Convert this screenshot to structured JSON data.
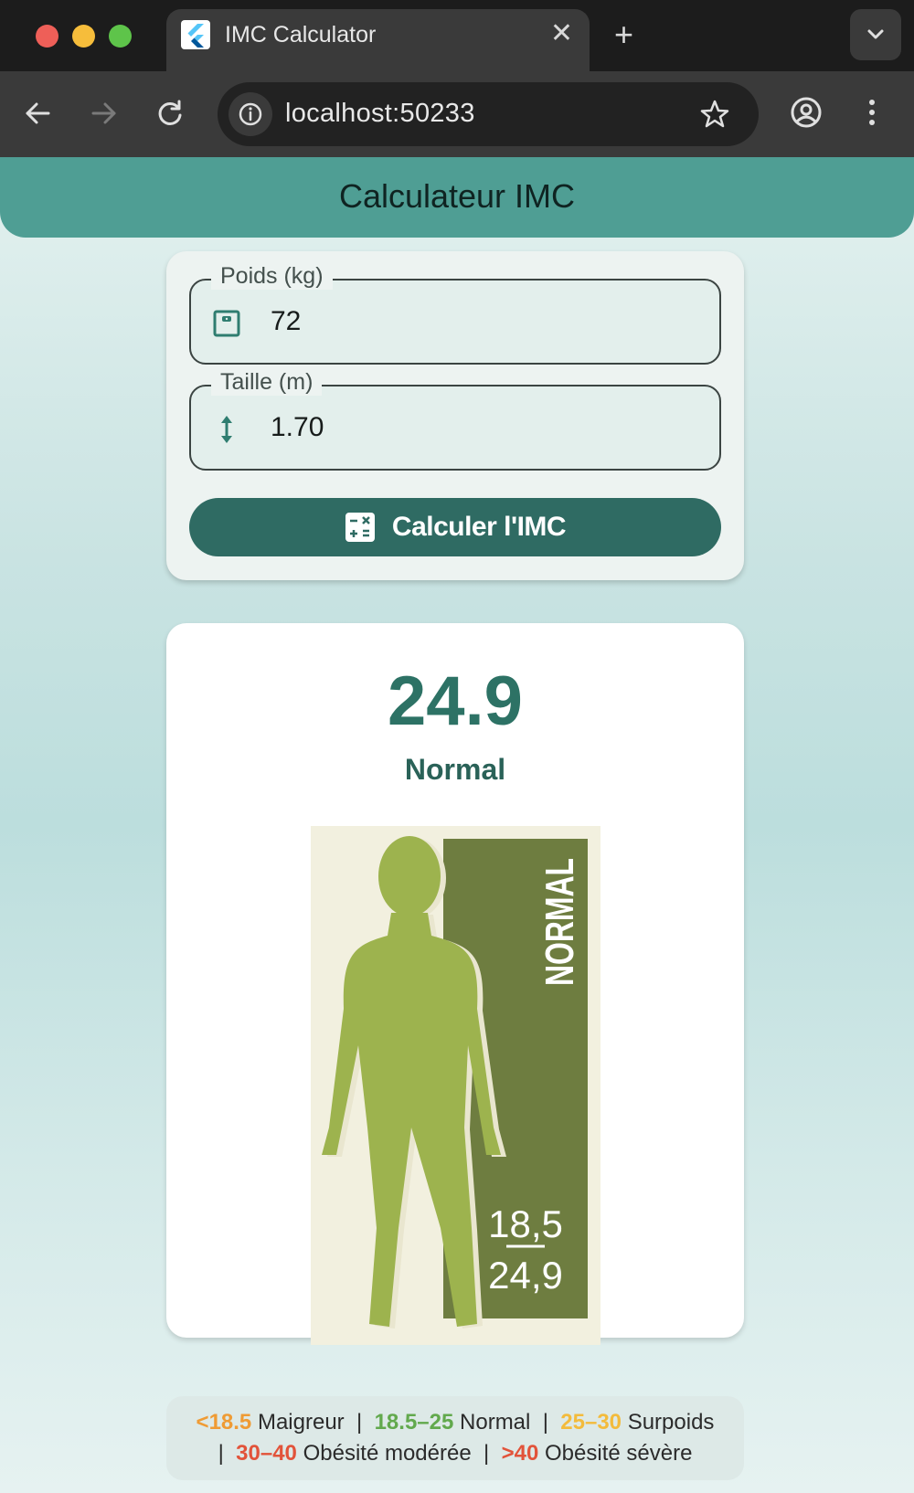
{
  "browser": {
    "tab_title": "IMC Calculator",
    "tab_close": "✕",
    "new_tab": "+",
    "url": "localhost:50233"
  },
  "app": {
    "title": "Calculateur IMC",
    "weight_field": {
      "label": "Poids (kg)",
      "value": "72"
    },
    "height_field": {
      "label": "Taille (m)",
      "value": "1.70"
    },
    "calculate_button": "Calculer l'IMC",
    "result": {
      "bmi": "24.9",
      "category": "Normal"
    },
    "figure_image": {
      "band_label": "NORMAL",
      "range_low": "18,5",
      "range_high": "24,9",
      "colors": {
        "background": "#f2f0df",
        "band": "#6e7d40",
        "silhouette": "#9db34e"
      }
    },
    "legend": [
      {
        "range": "<18.5",
        "label": "Maigreur",
        "color": "#ef9b34"
      },
      {
        "range": "18.5–25",
        "label": "Normal",
        "color": "#62a94d"
      },
      {
        "range": "25–30",
        "label": "Surpoids",
        "color": "#f3bb3c"
      },
      {
        "range": "30–40",
        "label": "Obésité modérée",
        "color": "#e2533a"
      },
      {
        "range": ">40",
        "label": "Obésité sévère",
        "color": "#e2533a"
      }
    ],
    "legend_separator": "|"
  },
  "colors": {
    "appbar": "#4f9e94",
    "accent": "#2f6b63",
    "bmi_text": "#2d7265"
  }
}
